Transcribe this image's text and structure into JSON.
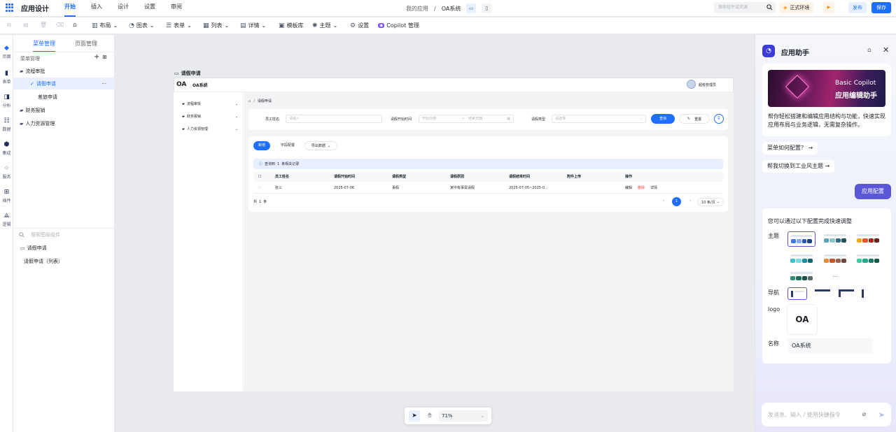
{
  "topbar": {
    "app_title": "应用设计",
    "tabs": [
      "开始",
      "插入",
      "设计",
      "设置",
      "审阅"
    ],
    "breadcrumb_parent": "我的应用",
    "breadcrumb_sep": "/",
    "breadcrumb_current": "OA系统",
    "search_placeholder": "搜索组件或资源",
    "env_label": "正式环境",
    "publish_label": "发布",
    "save_label": "保存"
  },
  "toolbar": {
    "layout": "布局",
    "chart": "图表",
    "form": "表单",
    "list": "列表",
    "detail": "详情",
    "template": "模板库",
    "theme": "主题",
    "settings": "设置",
    "copilot": "Copilot 管理"
  },
  "rail": [
    "页面",
    "表单",
    "分析",
    "数据",
    "集成",
    "服务",
    "插件",
    "逻辑"
  ],
  "sidebar": {
    "tab_menu": "菜单管理",
    "tab_page": "页面管理",
    "section_title": "菜单管理",
    "items": [
      {
        "label": "流程审批"
      },
      {
        "label": "请假申请"
      },
      {
        "label": "差旅申请"
      },
      {
        "label": "财务报销"
      },
      {
        "label": "人力资源管理"
      }
    ],
    "search_placeholder": "搜索图层组件",
    "layers": [
      "请假申请",
      "请假申请（列表）"
    ]
  },
  "canvas": {
    "page_title": "请假申请",
    "app_name": "OA系统",
    "logo_text": "OA",
    "user_name": "超级管理员",
    "menu": [
      "流程审批",
      "财务报销",
      "人力资源管理"
    ],
    "breadcrumb": "请假申请",
    "filters": {
      "employee_label": "员工姓名",
      "employee_placeholder": "请输入",
      "start_label": "请假开始时间",
      "start_placeholder": "开始日期",
      "end_placeholder": "结束日期",
      "type_label": "请假类型",
      "type_placeholder": "请选择",
      "query": "查询",
      "reset": "重置"
    },
    "actions": {
      "add": "新增",
      "field_config": "字段配置",
      "export": "导出数据"
    },
    "info_prefix": "查询到",
    "info_count": "1",
    "info_suffix": "条相关记录",
    "columns": [
      "员工姓名",
      "请假开始时间",
      "请假类型",
      "请假原因",
      "请假结束时间",
      "附件上传",
      "操作"
    ],
    "rows": [
      {
        "name": "张三",
        "start": "2025-07-06",
        "type": "事假",
        "reason": "家中有事需请假",
        "end": "2025-07-05~2025-0...",
        "attachment": "",
        "op_edit": "编辑",
        "op_delete": "删除",
        "op_detail": "详情"
      }
    ],
    "total_prefix": "共",
    "total_count": "1",
    "total_suffix": "条",
    "page": "1",
    "page_size": "10 条/页"
  },
  "zoom": {
    "level": "71%"
  },
  "assistant": {
    "title": "应用助手",
    "banner_line1": "Basic Copilot",
    "banner_line2": "应用编辑助手",
    "intro": "帮你轻松搭建和编辑应用结构与功能，快速实现应用布局与业务逻辑，无需复杂操作。",
    "suggestions": [
      "菜单如何配置？",
      "帮我切换到工业风主题"
    ],
    "user_msg": "应用配置",
    "config_intro": "您可以通过以下配置完成快速调整",
    "theme_label": "主题",
    "nav_label": "导航",
    "logo_label": "logo",
    "name_label": "名称",
    "name_value": "OA系统",
    "more": "...",
    "input_placeholder": "发消息、输入 / 使用快捷指令",
    "themes": [
      [
        "#3b78e7",
        "#7fa8f0",
        "#2755b8",
        "#1e3f8a"
      ],
      [
        "#5aa5b5",
        "#8fc4cf",
        "#2f6f7d",
        "#24505a"
      ],
      [
        "#f2a51a",
        "#e0572b",
        "#a4281f",
        "#6e1f18"
      ],
      [
        "#3dc2c9",
        "#79dbe0",
        "#1b8f99",
        "#136870"
      ],
      [
        "#e58a3d",
        "#c9552d",
        "#9b6150",
        "#6e4a3e"
      ],
      [
        "#38c9a3",
        "#25a98a",
        "#1b7b66",
        "#14584a"
      ],
      [
        "#2e8b75",
        "#1f6e5c",
        "#164f43",
        "#5a6d6a"
      ]
    ]
  }
}
